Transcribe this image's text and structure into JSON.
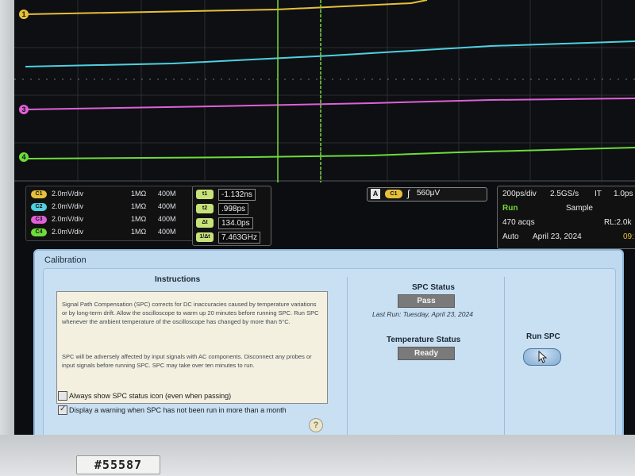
{
  "asset_tag": "#55587",
  "channels": [
    {
      "id": "C1",
      "volts_div": "2.0mV/div",
      "impedance": "1MΩ",
      "bandwidth": "400M",
      "color": "#e6c03a"
    },
    {
      "id": "C2",
      "volts_div": "2.0mV/div",
      "impedance": "1MΩ",
      "bandwidth": "400M",
      "color": "#4fd0e0"
    },
    {
      "id": "C3",
      "volts_div": "2.0mV/div",
      "impedance": "1MΩ",
      "bandwidth": "400M",
      "color": "#e060d8"
    },
    {
      "id": "C4",
      "volts_div": "2.0mV/div",
      "impedance": "1MΩ",
      "bandwidth": "400M",
      "color": "#6ddc3a"
    }
  ],
  "trace_markers": [
    "1",
    "3",
    "4"
  ],
  "cursors": [
    {
      "label": "t1",
      "value": "-1.132ns"
    },
    {
      "label": "t2",
      "value": ".998ps"
    },
    {
      "label": "Δt",
      "value": "134.0ps"
    },
    {
      "label": "1/Δt",
      "value": "7.463GHz"
    }
  ],
  "trigger": {
    "source_letter": "A",
    "channel": "C1",
    "slope": "∫",
    "level": "560μV"
  },
  "acquisition": {
    "horizontal_scale": "200ps/div",
    "sample_rate": "2.5GS/s",
    "mode_code": "IT",
    "resolution": "1.0ps",
    "state": "Run",
    "acq_mode": "Sample",
    "acq_count": "470 acqs",
    "record_length": "RL:2.0k",
    "trigger_mode": "Auto",
    "date": "April 23, 2024",
    "time": "09:"
  },
  "calibration": {
    "title": "Calibration",
    "instructions_heading": "Instructions",
    "instructions_p1": "Signal Path Compensation (SPC) corrects for DC inaccuracies caused by temperature variations or by long-term drift. Allow the oscilloscope to warm up 20 minutes before running SPC. Run SPC whenever the ambient temperature of the oscilloscope has changed by more than 5°C.",
    "instructions_p2": "SPC will be adversely affected by input signals with AC components. Disconnect any probes or input signals before running SPC. SPC may take over ten minutes to run.",
    "checkbox_always_show": {
      "label": "Always show SPC status icon (even when passing)",
      "checked": false
    },
    "checkbox_warning": {
      "label": "Display a warning when SPC has not been run in more than a month",
      "checked": true
    },
    "spc_status_heading": "SPC Status",
    "spc_status_value": "Pass",
    "last_run": "Last Run: Tuesday, April 23, 2024",
    "temperature_heading": "Temperature Status",
    "temperature_value": "Ready",
    "run_spc_label": "Run SPC"
  },
  "colors": {
    "panel_bg": "#c9e0f3",
    "status_pill": "#7a7a7a",
    "accent": "#4d78a3"
  }
}
